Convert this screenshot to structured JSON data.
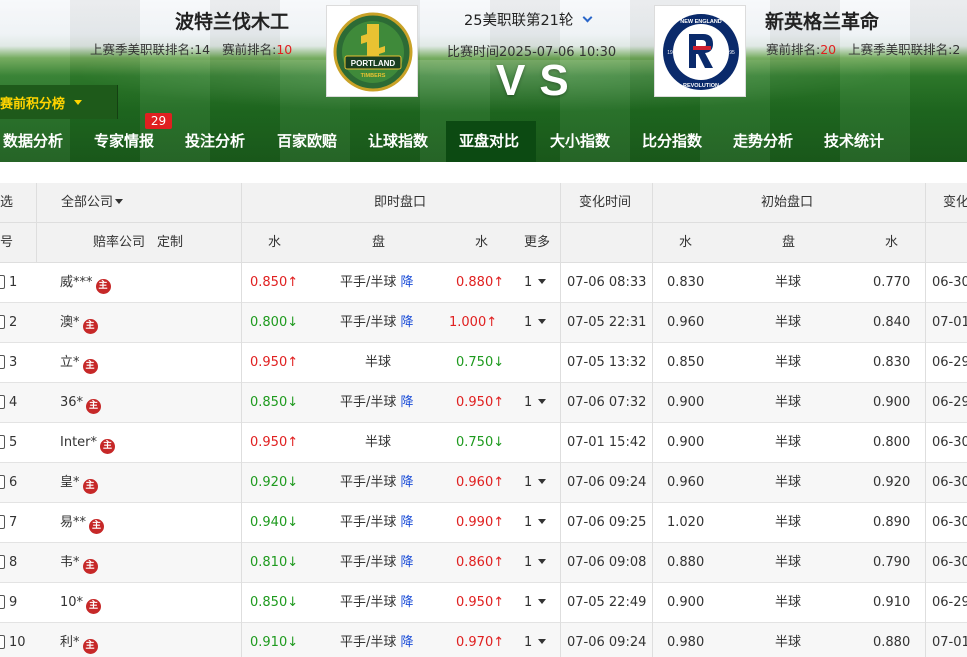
{
  "match": {
    "title": "25美职联第21轮",
    "time_label": "比赛时间2025-07-06 10:30",
    "vs_text": "VS",
    "home": {
      "name": "波特兰伐木工",
      "last_season_label": "上赛季美职联排名:14",
      "pre_rank_label": "赛前排名:",
      "pre_rank_value": "10",
      "logo_text": "PORTLAND",
      "logo_subtext": "TIMBERS"
    },
    "away": {
      "name": "新英格兰革命",
      "pre_rank_label": "赛前排名:",
      "pre_rank_value": "20",
      "last_season_label": "上赛季美职联排名:2",
      "logo_top": "NEW ENGLAND",
      "logo_bottom": "REVOLUTION",
      "logo_year_left": "19",
      "logo_year_right": "95"
    }
  },
  "rank_tab": {
    "label": "赛前积分榜"
  },
  "nav": {
    "items": [
      "数据分析",
      "专家情报",
      "投注分析",
      "百家欧赔",
      "让球指数",
      "亚盘对比",
      "大小指数",
      "比分指数",
      "走势分析",
      "技术统计"
    ],
    "active_index": 5,
    "badge": "29"
  },
  "table": {
    "header1": {
      "select": "选",
      "company_filter": "全部公司",
      "live_odds": "即时盘口",
      "change_time": "变化时间",
      "initial_odds": "初始盘口",
      "change_cut": "变化"
    },
    "header2": {
      "index": "号",
      "company": "赔率公司",
      "custom": "定制",
      "water1": "水",
      "line": "盘",
      "water2": "水",
      "more": "更多",
      "i_water1": "水",
      "i_line": "盘",
      "i_water2": "水"
    },
    "zhu_label": "主",
    "down_label": "降",
    "rows": [
      {
        "no": "1",
        "company": "威***",
        "w1": "0.850",
        "w1dir": "up",
        "line": "平手/半球",
        "down": true,
        "w2": "0.880",
        "w2dir": "up",
        "more": "1",
        "time": "07-06 08:33",
        "iw1": "0.830",
        "iline": "半球",
        "iw2": "0.770",
        "ctime": "06-30"
      },
      {
        "no": "2",
        "company": "澳*",
        "w1": "0.800",
        "w1dir": "down",
        "line": "平手/半球",
        "down": true,
        "w2": "1.000",
        "w2dir": "up",
        "more": "1",
        "time": "07-05 22:31",
        "iw1": "0.960",
        "iline": "半球",
        "iw2": "0.840",
        "ctime": "07-01"
      },
      {
        "no": "3",
        "company": "立*",
        "w1": "0.950",
        "w1dir": "up",
        "line": "半球",
        "down": false,
        "w2": "0.750",
        "w2dir": "down",
        "more": "",
        "time": "07-05 13:32",
        "iw1": "0.850",
        "iline": "半球",
        "iw2": "0.830",
        "ctime": "06-29"
      },
      {
        "no": "4",
        "company": "36*",
        "w1": "0.850",
        "w1dir": "down",
        "line": "平手/半球",
        "down": true,
        "w2": "0.950",
        "w2dir": "up",
        "more": "1",
        "time": "07-06 07:32",
        "iw1": "0.900",
        "iline": "半球",
        "iw2": "0.900",
        "ctime": "06-29"
      },
      {
        "no": "5",
        "company": "Inter*",
        "w1": "0.950",
        "w1dir": "up",
        "line": "半球",
        "down": false,
        "w2": "0.750",
        "w2dir": "down",
        "more": "",
        "time": "07-01 15:42",
        "iw1": "0.900",
        "iline": "半球",
        "iw2": "0.800",
        "ctime": "06-30"
      },
      {
        "no": "6",
        "company": "皇*",
        "w1": "0.920",
        "w1dir": "down",
        "line": "平手/半球",
        "down": true,
        "w2": "0.960",
        "w2dir": "up",
        "more": "1",
        "time": "07-06 09:24",
        "iw1": "0.960",
        "iline": "半球",
        "iw2": "0.920",
        "ctime": "06-30"
      },
      {
        "no": "7",
        "company": "易**",
        "w1": "0.940",
        "w1dir": "down",
        "line": "平手/半球",
        "down": true,
        "w2": "0.990",
        "w2dir": "up",
        "more": "1",
        "time": "07-06 09:25",
        "iw1": "1.020",
        "iline": "半球",
        "iw2": "0.890",
        "ctime": "06-30"
      },
      {
        "no": "8",
        "company": "韦*",
        "w1": "0.810",
        "w1dir": "down",
        "line": "平手/半球",
        "down": true,
        "w2": "0.860",
        "w2dir": "up",
        "more": "1",
        "time": "07-06 09:08",
        "iw1": "0.880",
        "iline": "半球",
        "iw2": "0.790",
        "ctime": "06-30"
      },
      {
        "no": "9",
        "company": "10*",
        "w1": "0.850",
        "w1dir": "down",
        "line": "平手/半球",
        "down": true,
        "w2": "0.950",
        "w2dir": "up",
        "more": "1",
        "time": "07-05 22:49",
        "iw1": "0.900",
        "iline": "半球",
        "iw2": "0.910",
        "ctime": "06-29"
      },
      {
        "no": "10",
        "company": "利*",
        "w1": "0.910",
        "w1dir": "down",
        "line": "平手/半球",
        "down": true,
        "w2": "0.970",
        "w2dir": "up",
        "more": "1",
        "time": "07-06 09:24",
        "iw1": "0.980",
        "iline": "半球",
        "iw2": "0.880",
        "ctime": "07-01"
      }
    ]
  },
  "colors": {
    "up": "#e02020",
    "down": "#1e9a1e",
    "accent_green": "#1e5a1a",
    "link_blue": "#1d4fd8"
  }
}
